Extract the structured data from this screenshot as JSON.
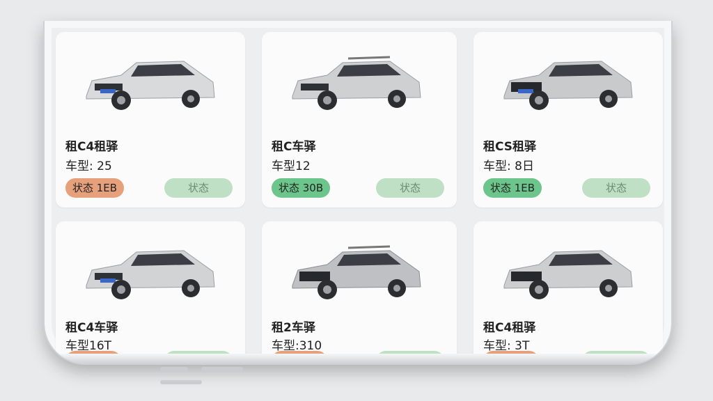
{
  "cards": [
    {
      "name": "租C4租驿",
      "model": "车型: 25",
      "status": "状态 1EB",
      "status_color": "#e6a07c",
      "action": "状态"
    },
    {
      "name": "租C车驿",
      "model": "车型12",
      "status": "状态 30B",
      "status_color": "#6cc58a",
      "action": "状态"
    },
    {
      "name": "租CS租驿",
      "model": "车型: 8日",
      "status": "状态 1EB",
      "status_color": "#6cc58a",
      "action": "状态"
    },
    {
      "name": "租C4车驿",
      "model": "车型16T",
      "status": "",
      "status_color": "#e6a07c",
      "action": ""
    },
    {
      "name": "租2车驿",
      "model": "车型:310",
      "status": "",
      "status_color": "#e6a07c",
      "action": ""
    },
    {
      "name": "租C4租驿",
      "model": "车型: 3T",
      "status": "",
      "status_color": "#e6a07c",
      "action": ""
    }
  ],
  "car_icon": "suv-car-image"
}
